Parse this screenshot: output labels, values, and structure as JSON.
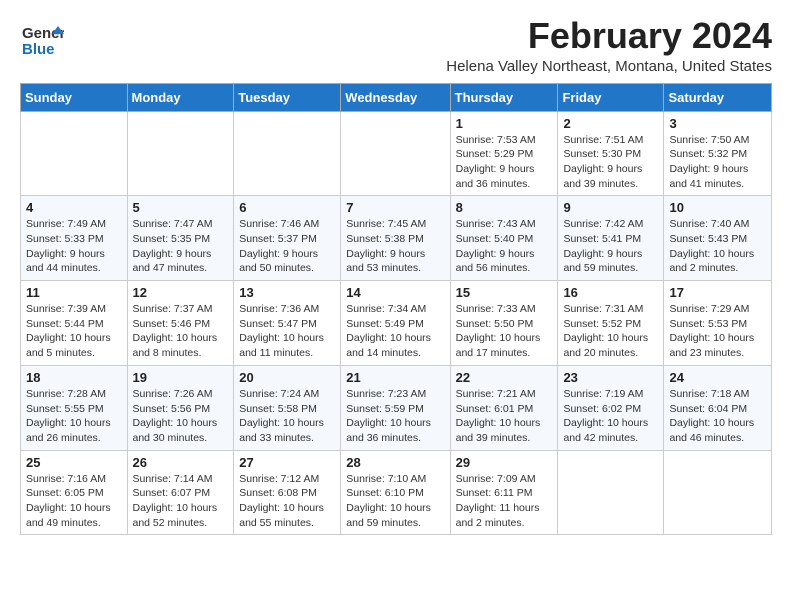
{
  "logo": {
    "text_general": "General",
    "text_blue": "Blue"
  },
  "title": "February 2024",
  "location": "Helena Valley Northeast, Montana, United States",
  "headers": [
    "Sunday",
    "Monday",
    "Tuesday",
    "Wednesday",
    "Thursday",
    "Friday",
    "Saturday"
  ],
  "weeks": [
    [
      {
        "day": "",
        "info": ""
      },
      {
        "day": "",
        "info": ""
      },
      {
        "day": "",
        "info": ""
      },
      {
        "day": "",
        "info": ""
      },
      {
        "day": "1",
        "info": "Sunrise: 7:53 AM\nSunset: 5:29 PM\nDaylight: 9 hours and 36 minutes."
      },
      {
        "day": "2",
        "info": "Sunrise: 7:51 AM\nSunset: 5:30 PM\nDaylight: 9 hours and 39 minutes."
      },
      {
        "day": "3",
        "info": "Sunrise: 7:50 AM\nSunset: 5:32 PM\nDaylight: 9 hours and 41 minutes."
      }
    ],
    [
      {
        "day": "4",
        "info": "Sunrise: 7:49 AM\nSunset: 5:33 PM\nDaylight: 9 hours and 44 minutes."
      },
      {
        "day": "5",
        "info": "Sunrise: 7:47 AM\nSunset: 5:35 PM\nDaylight: 9 hours and 47 minutes."
      },
      {
        "day": "6",
        "info": "Sunrise: 7:46 AM\nSunset: 5:37 PM\nDaylight: 9 hours and 50 minutes."
      },
      {
        "day": "7",
        "info": "Sunrise: 7:45 AM\nSunset: 5:38 PM\nDaylight: 9 hours and 53 minutes."
      },
      {
        "day": "8",
        "info": "Sunrise: 7:43 AM\nSunset: 5:40 PM\nDaylight: 9 hours and 56 minutes."
      },
      {
        "day": "9",
        "info": "Sunrise: 7:42 AM\nSunset: 5:41 PM\nDaylight: 9 hours and 59 minutes."
      },
      {
        "day": "10",
        "info": "Sunrise: 7:40 AM\nSunset: 5:43 PM\nDaylight: 10 hours and 2 minutes."
      }
    ],
    [
      {
        "day": "11",
        "info": "Sunrise: 7:39 AM\nSunset: 5:44 PM\nDaylight: 10 hours and 5 minutes."
      },
      {
        "day": "12",
        "info": "Sunrise: 7:37 AM\nSunset: 5:46 PM\nDaylight: 10 hours and 8 minutes."
      },
      {
        "day": "13",
        "info": "Sunrise: 7:36 AM\nSunset: 5:47 PM\nDaylight: 10 hours and 11 minutes."
      },
      {
        "day": "14",
        "info": "Sunrise: 7:34 AM\nSunset: 5:49 PM\nDaylight: 10 hours and 14 minutes."
      },
      {
        "day": "15",
        "info": "Sunrise: 7:33 AM\nSunset: 5:50 PM\nDaylight: 10 hours and 17 minutes."
      },
      {
        "day": "16",
        "info": "Sunrise: 7:31 AM\nSunset: 5:52 PM\nDaylight: 10 hours and 20 minutes."
      },
      {
        "day": "17",
        "info": "Sunrise: 7:29 AM\nSunset: 5:53 PM\nDaylight: 10 hours and 23 minutes."
      }
    ],
    [
      {
        "day": "18",
        "info": "Sunrise: 7:28 AM\nSunset: 5:55 PM\nDaylight: 10 hours and 26 minutes."
      },
      {
        "day": "19",
        "info": "Sunrise: 7:26 AM\nSunset: 5:56 PM\nDaylight: 10 hours and 30 minutes."
      },
      {
        "day": "20",
        "info": "Sunrise: 7:24 AM\nSunset: 5:58 PM\nDaylight: 10 hours and 33 minutes."
      },
      {
        "day": "21",
        "info": "Sunrise: 7:23 AM\nSunset: 5:59 PM\nDaylight: 10 hours and 36 minutes."
      },
      {
        "day": "22",
        "info": "Sunrise: 7:21 AM\nSunset: 6:01 PM\nDaylight: 10 hours and 39 minutes."
      },
      {
        "day": "23",
        "info": "Sunrise: 7:19 AM\nSunset: 6:02 PM\nDaylight: 10 hours and 42 minutes."
      },
      {
        "day": "24",
        "info": "Sunrise: 7:18 AM\nSunset: 6:04 PM\nDaylight: 10 hours and 46 minutes."
      }
    ],
    [
      {
        "day": "25",
        "info": "Sunrise: 7:16 AM\nSunset: 6:05 PM\nDaylight: 10 hours and 49 minutes."
      },
      {
        "day": "26",
        "info": "Sunrise: 7:14 AM\nSunset: 6:07 PM\nDaylight: 10 hours and 52 minutes."
      },
      {
        "day": "27",
        "info": "Sunrise: 7:12 AM\nSunset: 6:08 PM\nDaylight: 10 hours and 55 minutes."
      },
      {
        "day": "28",
        "info": "Sunrise: 7:10 AM\nSunset: 6:10 PM\nDaylight: 10 hours and 59 minutes."
      },
      {
        "day": "29",
        "info": "Sunrise: 7:09 AM\nSunset: 6:11 PM\nDaylight: 11 hours and 2 minutes."
      },
      {
        "day": "",
        "info": ""
      },
      {
        "day": "",
        "info": ""
      }
    ]
  ]
}
